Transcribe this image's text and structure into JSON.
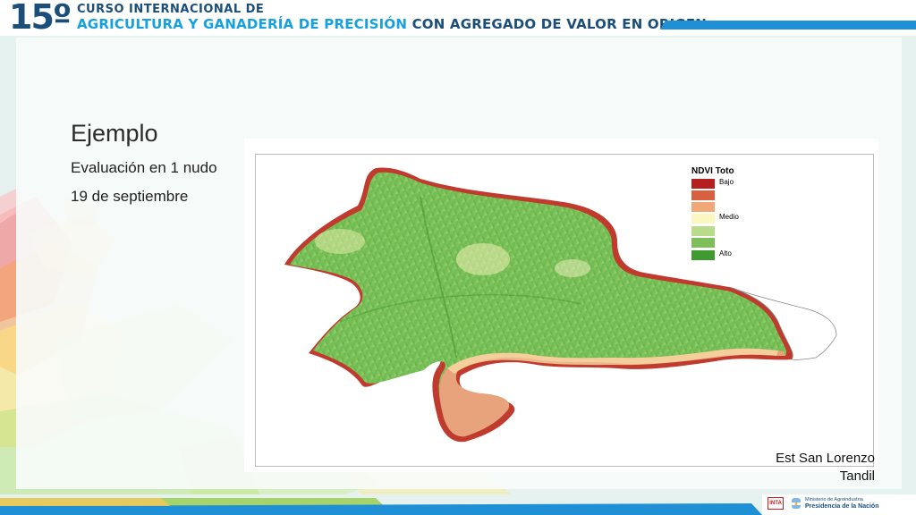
{
  "header": {
    "number": "15º",
    "line1": "CURSO INTERNACIONAL DE",
    "line2_part1": "AGRICULTURA Y GANADERÍA DE PRECISIÓN",
    "line2_part2": "CON AGREGADO DE VALOR EN ORIGEN"
  },
  "slide": {
    "title": "Ejemplo",
    "subtitle1": "Evaluación en 1 nudo",
    "subtitle2": "19 de septiembre"
  },
  "legend": {
    "title": "NDVI Toto",
    "items": [
      {
        "label": "Bajo",
        "color": "#b51f1f"
      },
      {
        "label": "",
        "color": "#d9603f"
      },
      {
        "label": "",
        "color": "#f0a878"
      },
      {
        "label": "Medio",
        "color": "#fbf7c0"
      },
      {
        "label": "",
        "color": "#b8dc8a"
      },
      {
        "label": "",
        "color": "#7dc05a"
      },
      {
        "label": "Alto",
        "color": "#3f9a2f"
      }
    ]
  },
  "station": {
    "line1": "Est San Lorenzo",
    "line2": "Tandil"
  },
  "footer": {
    "inta": "INTA",
    "ministry": "Ministerio de Agroindustria",
    "presidencia": "Presidencia de la Nación"
  },
  "colors": {
    "header_dark": "#1b4f7a",
    "header_light": "#16a0df",
    "bar_blue": "#1f8fd6"
  }
}
